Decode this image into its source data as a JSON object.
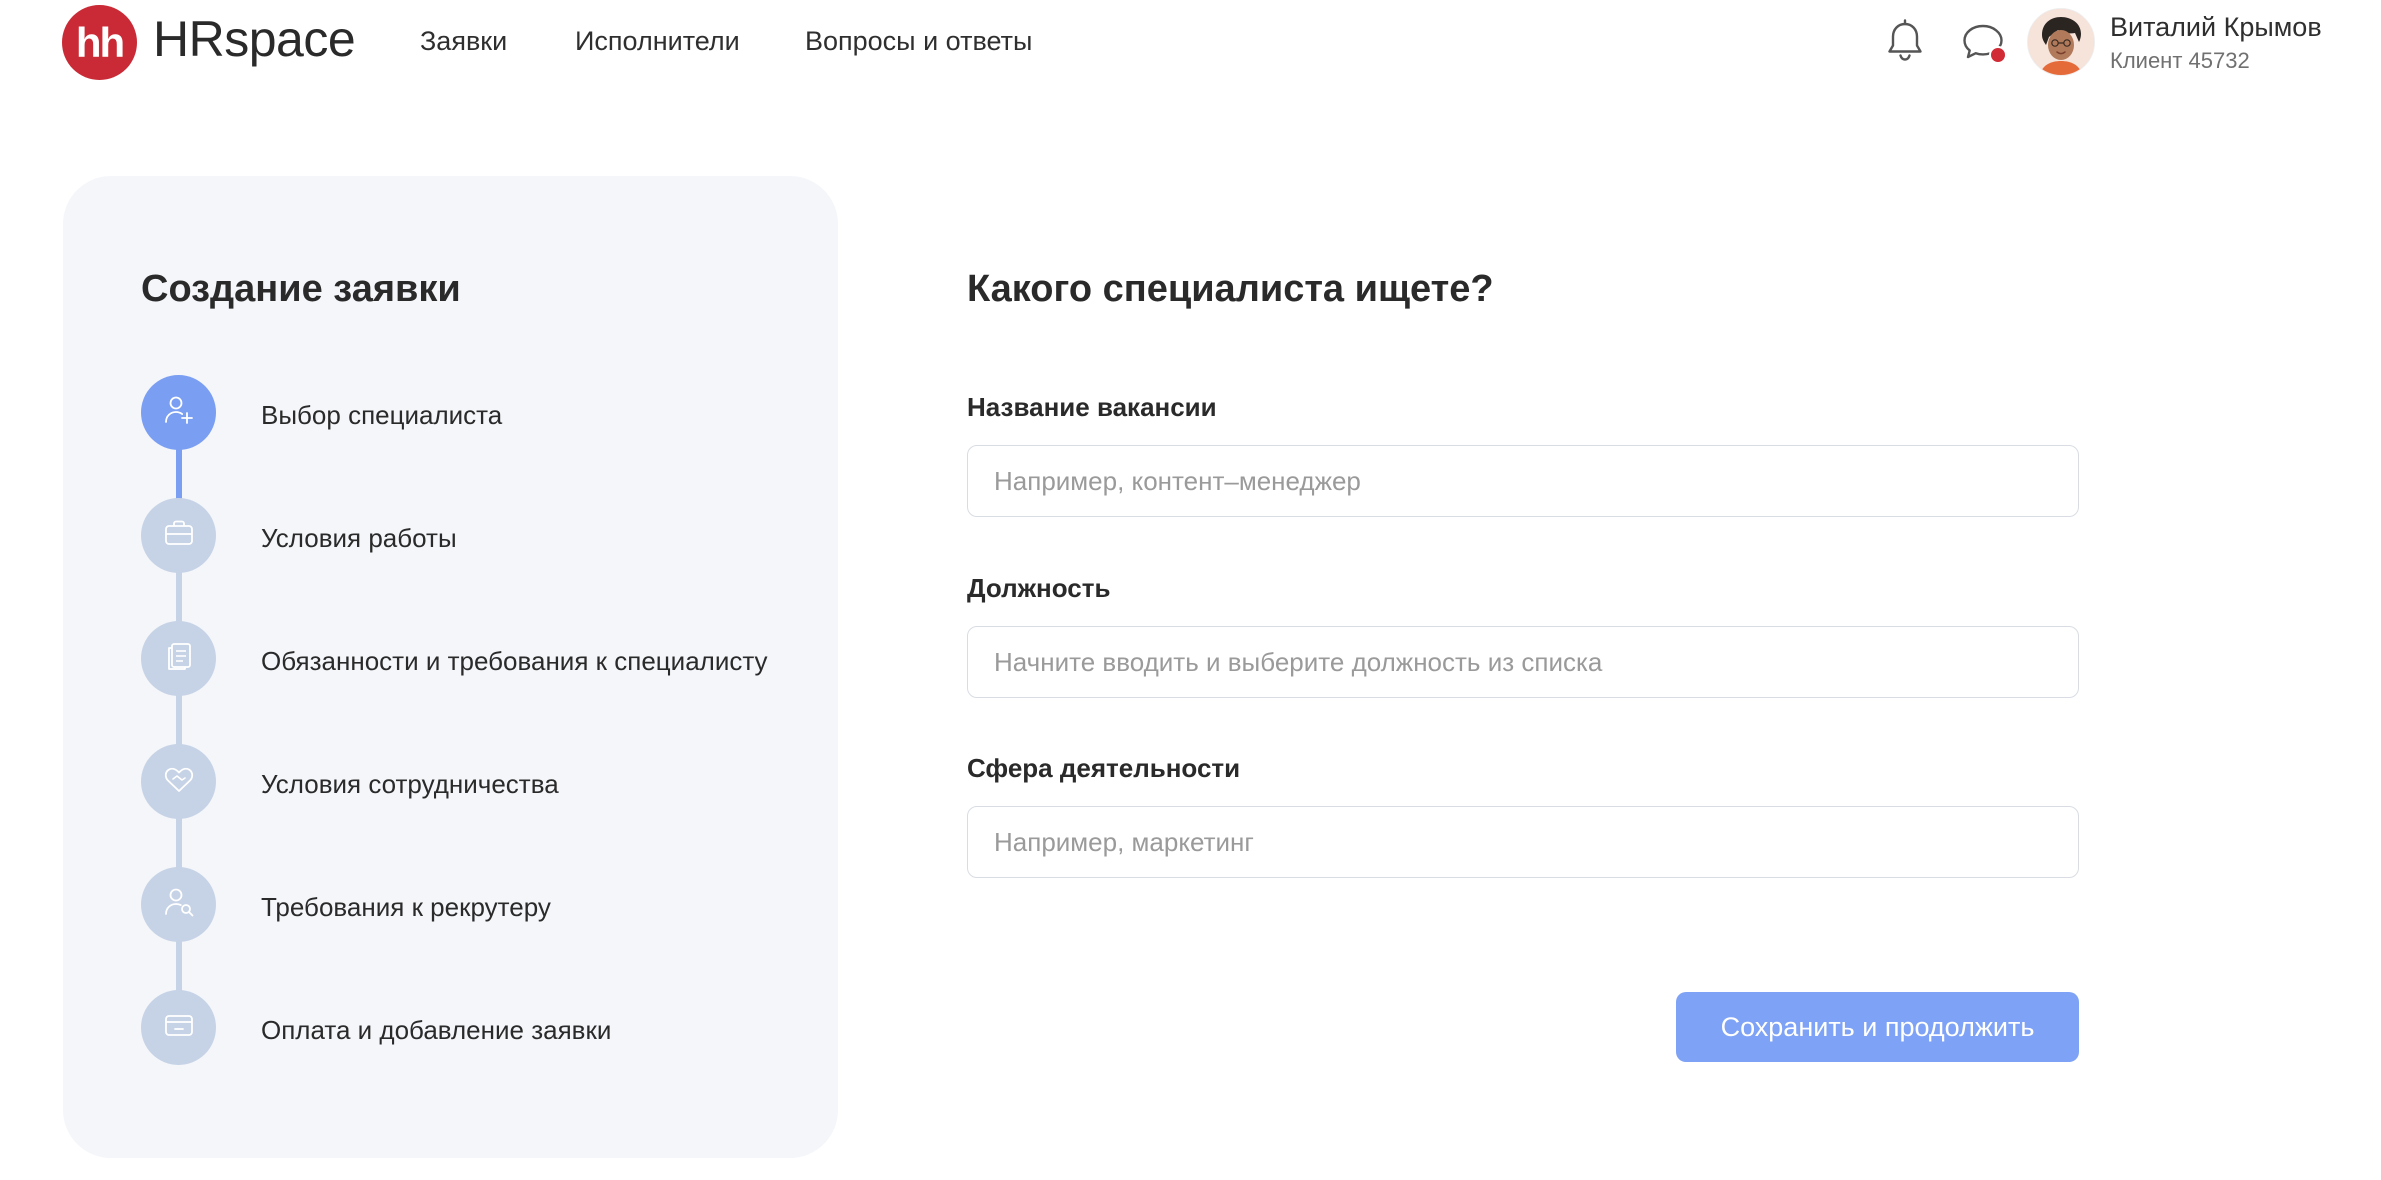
{
  "header": {
    "logo_mark": "hh",
    "logo_text": "HRspace",
    "nav": [
      {
        "label": "Заявки"
      },
      {
        "label": "Исполнители"
      },
      {
        "label": "Вопросы и ответы"
      }
    ],
    "notifications_icon": "bell-icon",
    "messages_icon": "chat-icon",
    "messages_badge_color": "#d12b35",
    "user": {
      "name": "Виталий Крымов",
      "client": "Клиент 45732"
    }
  },
  "sidebar": {
    "title": "Создание заявки",
    "active_color": "#7a9ef2",
    "inactive_color": "#c6d3e6",
    "steps": [
      {
        "label": "Выбор специалиста",
        "icon": "user-plus-icon",
        "active": true
      },
      {
        "label": "Условия работы",
        "icon": "briefcase-icon",
        "active": false
      },
      {
        "label": "Обязанности и требования к специалисту",
        "icon": "clipboard-icon",
        "active": false
      },
      {
        "label": "Условия сотрудничества",
        "icon": "handshake-heart-icon",
        "active": false
      },
      {
        "label": "Требования к рекрутеру",
        "icon": "user-search-icon",
        "active": false
      },
      {
        "label": "Оплата и добавление заявки",
        "icon": "card-icon",
        "active": false
      }
    ]
  },
  "form": {
    "title": "Какого специалиста ищете?",
    "fields": [
      {
        "label": "Название вакансии",
        "value": "",
        "placeholder": "Например, контент–менеджер"
      },
      {
        "label": "Должность",
        "value": "",
        "placeholder": "Начните вводить и выберите должность из списка"
      },
      {
        "label": "Сфера деятельности",
        "value": "",
        "placeholder": "Например, маркетинг"
      }
    ],
    "submit_label": "Сохранить и продолжить",
    "submit_color": "#7ea2f5"
  }
}
